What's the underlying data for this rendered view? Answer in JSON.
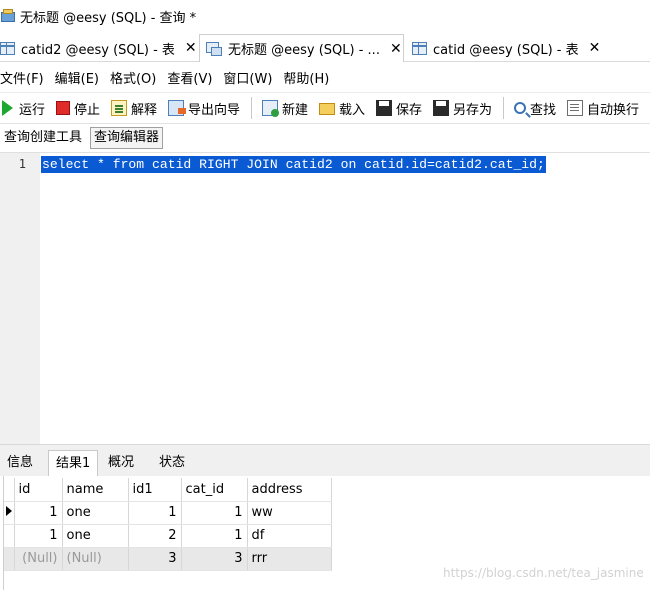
{
  "window": {
    "title": "无标题 @eesy (SQL) - 查询 *"
  },
  "tabs": [
    {
      "label": "catid2 @eesy (SQL) - 表",
      "close": "✕"
    },
    {
      "label": "无标题 @eesy (SQL) - ...",
      "close": "✕"
    },
    {
      "label": "catid @eesy (SQL) - 表",
      "close": "✕"
    }
  ],
  "menu": [
    "文件(F)",
    "编辑(E)",
    "格式(O)",
    "查看(V)",
    "窗口(W)",
    "帮助(H)"
  ],
  "toolbar": {
    "run": "运行",
    "stop": "停止",
    "explain": "解释",
    "export": "导出向导",
    "new": "新建",
    "load": "载入",
    "save": "保存",
    "saveas": "另存为",
    "find": "查找",
    "wrap": "自动换行"
  },
  "subtabs": [
    "查询创建工具",
    "查询编辑器"
  ],
  "editor": {
    "line_number": "1",
    "sql": "select * from catid RIGHT JOIN catid2 on catid.id=catid2.cat_id;"
  },
  "result_tabs": [
    "信息",
    "结果1",
    "概况",
    "状态"
  ],
  "grid": {
    "columns": [
      "id",
      "name",
      "id1",
      "cat_id",
      "address"
    ],
    "rows": [
      [
        "1",
        "one",
        "1",
        "1",
        "ww"
      ],
      [
        "1",
        "one",
        "2",
        "1",
        "df"
      ],
      [
        "(Null)",
        "(Null)",
        "3",
        "3",
        "rrr"
      ]
    ]
  },
  "watermark": "https://blog.csdn.net/tea_jasmine"
}
